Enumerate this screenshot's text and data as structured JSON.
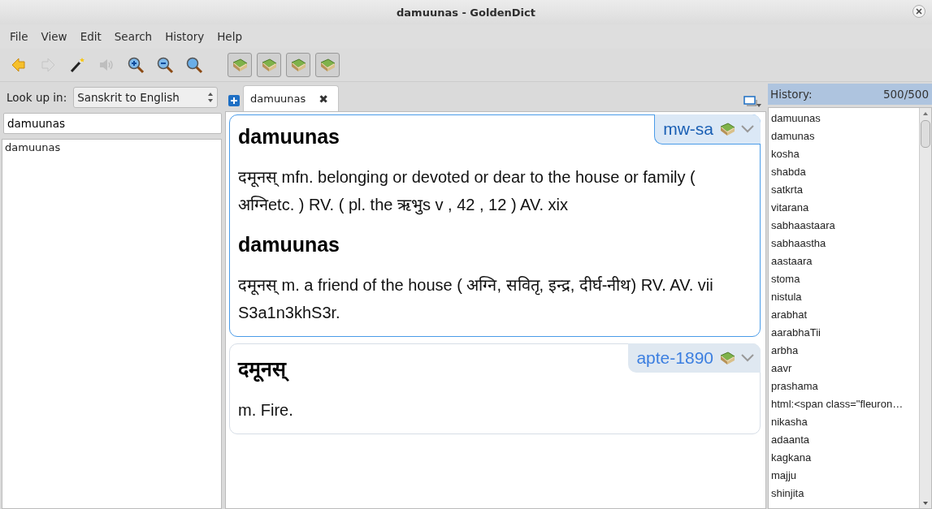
{
  "window": {
    "title": "damuunas - GoldenDict"
  },
  "menu": [
    {
      "label": "File"
    },
    {
      "label": "View"
    },
    {
      "label": "Edit"
    },
    {
      "label": "Search"
    },
    {
      "label": "History"
    },
    {
      "label": "Help"
    }
  ],
  "toolbar": [
    {
      "kind": "back",
      "disabled": false
    },
    {
      "kind": "forward",
      "disabled": true
    },
    {
      "kind": "wand",
      "disabled": false
    },
    {
      "kind": "sound",
      "disabled": true
    },
    {
      "kind": "zoom-in",
      "disabled": false
    },
    {
      "kind": "zoom-out",
      "disabled": false
    },
    {
      "kind": "zoom-reset",
      "disabled": false
    }
  ],
  "dictionary_buttons": [
    {
      "checked": true
    },
    {
      "checked": true
    },
    {
      "checked": true
    },
    {
      "checked": true
    }
  ],
  "lookup": {
    "label": "Look up in:",
    "group": "Sanskrit to English",
    "query": "damuunas"
  },
  "matches": [
    {
      "text": "damuunas"
    }
  ],
  "tabs": [
    {
      "label": "damuunas",
      "close": "✖",
      "selected": true
    }
  ],
  "articles": [
    {
      "dictionary": "mw-sa",
      "active": true,
      "blocks": [
        {
          "kind": "heading",
          "text": "damuunas"
        },
        {
          "kind": "paragraph",
          "text": "दमूनस् mfn. belonging or devoted or dear to the house or family ( अग्निetc. ) RV. ( pl. the ऋभुs v , 42 , 12 ) AV. xix"
        },
        {
          "kind": "heading",
          "text": "damuunas"
        },
        {
          "kind": "paragraph",
          "text": "दमूनस् m. a friend of the house ( अग्नि, सवितृ, इन्द्र, दीर्घ-नीथ) RV. AV. vii S3a1n3khS3r."
        }
      ]
    },
    {
      "dictionary": "apte-1890",
      "active": false,
      "blocks": [
        {
          "kind": "heading",
          "text": "दमूनस्"
        },
        {
          "kind": "paragraph",
          "text": "m. Fire."
        }
      ]
    }
  ],
  "history": {
    "label": "History:",
    "count": "500/500",
    "items": [
      "damuunas",
      "damunas",
      "kosha",
      "shabda",
      "satkrta",
      "vitarana",
      "sabhaastaara",
      "sabhaastha",
      "aastaara",
      "stoma",
      "nistula",
      "arabhat",
      "aarabhaTii",
      "arbha",
      "aavr",
      "prashama",
      "html:<span class=\"fleuron…",
      "nikasha",
      "adaanta",
      "kagkana",
      "majju",
      "shinjita"
    ]
  }
}
